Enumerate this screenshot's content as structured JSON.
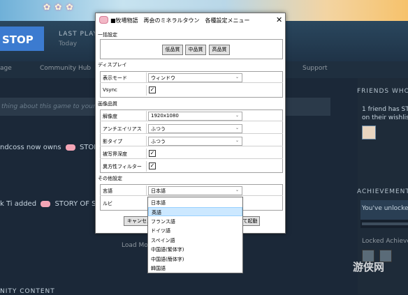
{
  "steam": {
    "stop_label": "STOP",
    "last_played_label": "LAST PLAY",
    "last_played_value": "Today",
    "nav": [
      "age",
      "Community Hub",
      "Support"
    ],
    "say_placeholder": "thing about this game to your",
    "feed": [
      {
        "user": "ndcoss now owns",
        "item": "STORY OF"
      },
      {
        "user": "k Ti added",
        "item": "STORY OF SEAS"
      }
    ],
    "load_more": "Load Mo",
    "community_content": "NITY CONTENT",
    "friends_title": "FRIENDS WHO",
    "friends_text_1": "1 friend has STO",
    "friends_text_2": "on their wishlist",
    "achievements_title": "ACHIEVEMENT",
    "achievements_text": "You've unlocked",
    "locked_title": "Locked Achieve",
    "watermark": "游侠网"
  },
  "dialog": {
    "title": "■牧場物語　再会のミネラルタウン　各種設定メニュー",
    "close": "✕",
    "sections": {
      "bulk": "一括設定",
      "display": "ディスプレイ",
      "quality": "画像品質",
      "other": "その他設定"
    },
    "quality_buttons": [
      "低品質",
      "中品質",
      "高品質"
    ],
    "display_rows": [
      {
        "label": "表示モード",
        "value": "ウィンドウ",
        "type": "combo"
      },
      {
        "label": "Vsync",
        "checked": true,
        "type": "check"
      }
    ],
    "quality_rows": [
      {
        "label": "解像度",
        "value": "1920x1080",
        "type": "combo"
      },
      {
        "label": "アンチエイリアス",
        "value": "ふつう",
        "type": "combo"
      },
      {
        "label": "影タイプ",
        "value": "ふつう",
        "type": "combo"
      },
      {
        "label": "被写界深度",
        "checked": true,
        "type": "check"
      },
      {
        "label": "異方性フィルター",
        "checked": true,
        "type": "check"
      }
    ],
    "other_rows": [
      {
        "label": "言語",
        "value": "日本語",
        "type": "combo"
      },
      {
        "label": "ルビ"
      }
    ],
    "cancel_label": "キャンセル",
    "launch_label": "て起動",
    "language_options": [
      "日本語",
      "英語",
      "フランス語",
      "ドイツ語",
      "スペイン語",
      "中国語(繁体字)",
      "中国語(簡体字)",
      "韓国語"
    ],
    "language_highlighted": "英語"
  }
}
